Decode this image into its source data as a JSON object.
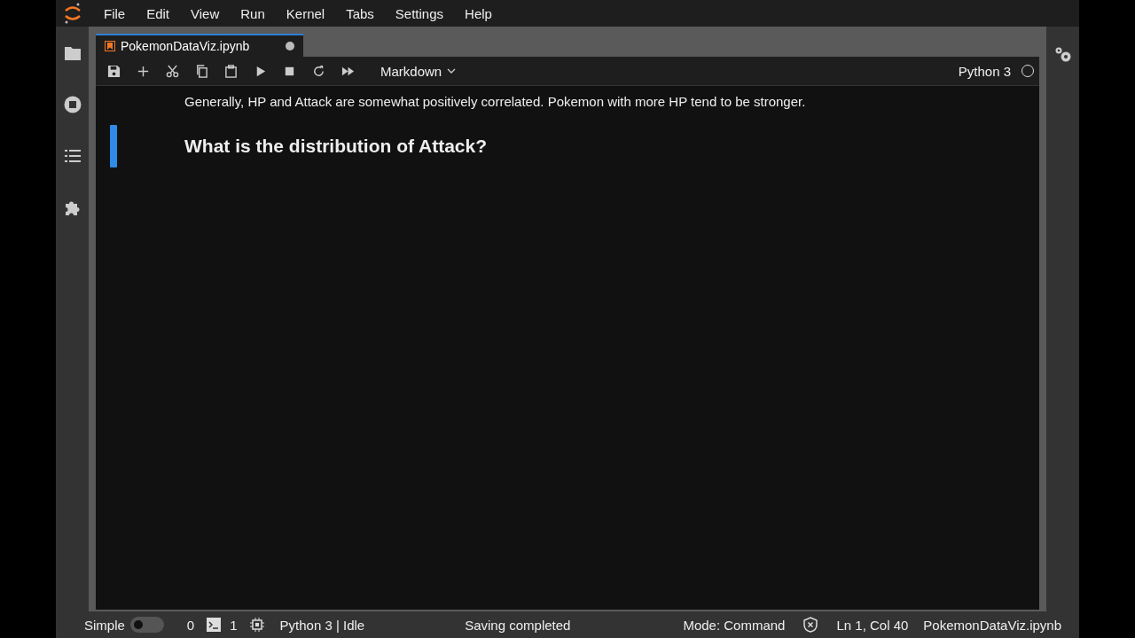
{
  "menu": [
    "File",
    "Edit",
    "View",
    "Run",
    "Kernel",
    "Tabs",
    "Settings",
    "Help"
  ],
  "tabs": [
    {
      "label": "PokemonDataViz.ipynb",
      "selected": true,
      "unsaved": true
    }
  ],
  "toolbar": {
    "cell_type": "Markdown",
    "kernel": "Python 3",
    "kernel_busy": false
  },
  "cells": [
    {
      "kind": "text",
      "text": "Generally, HP and Attack are somewhat positively correlated. Pokemon with more HP tend to be stronger.",
      "active": false
    },
    {
      "kind": "heading",
      "text": "What is the distribution of Attack?",
      "active": true
    }
  ],
  "status_bar": {
    "mode_label": "Simple",
    "simple_on": false,
    "terminals": "0",
    "kernels": "1",
    "kernel_status": "Python 3 | Idle",
    "message": "Saving completed",
    "mode": "Mode: Command",
    "position": "Ln 1, Col 40",
    "file": "PokemonDataViz.ipynb"
  }
}
